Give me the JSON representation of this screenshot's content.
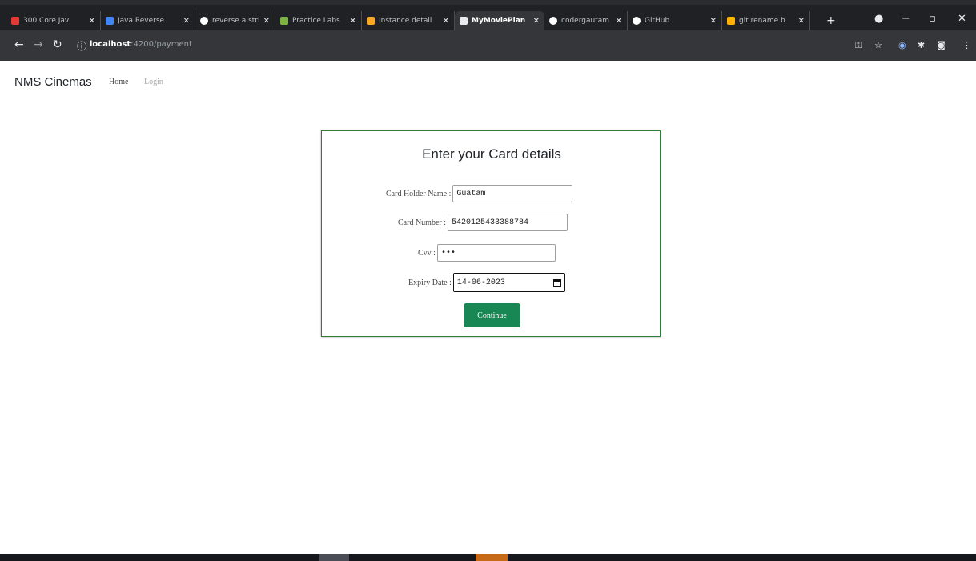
{
  "browser": {
    "tabs": [
      {
        "label": "300 Core Jav",
        "fav_color": "#e53935",
        "active": false
      },
      {
        "label": "Java Reverse",
        "fav_color": "#4285f4",
        "active": false
      },
      {
        "label": "reverse a strin",
        "fav_color": "#ffffff",
        "active": false
      },
      {
        "label": "Practice Labs",
        "fav_color": "#7cb342",
        "active": false
      },
      {
        "label": "Instance detail",
        "fav_color": "#f9a825",
        "active": false
      },
      {
        "label": "MyMoviePlan",
        "fav_color": "#e8eaed",
        "active": true
      },
      {
        "label": "codergautam",
        "fav_color": "#ffffff",
        "active": false
      },
      {
        "label": "GitHub",
        "fav_color": "#ffffff",
        "active": false
      },
      {
        "label": "git rename b",
        "fav_color": "#ffb300",
        "active": false
      }
    ],
    "url_host": "localhost",
    "url_path": ":4200/payment"
  },
  "navbar": {
    "brand": "NMS Cinemas",
    "links": [
      {
        "label": "Home",
        "color": "#444444"
      },
      {
        "label": "Login",
        "color": "#aaaaaa"
      }
    ]
  },
  "form": {
    "title": "Enter your Card details",
    "fields": {
      "holder": {
        "label": "Card Holder Name :",
        "value": "Guatam"
      },
      "number": {
        "label": "Card Number :",
        "value": "5420125433388784"
      },
      "cvv": {
        "label": "Cvv :",
        "value": "•••"
      },
      "expiry": {
        "label": "Expiry Date :",
        "value": "14-06-2023"
      }
    },
    "submit_label": "Continue"
  },
  "colors": {
    "accent_green": "#198754",
    "card_border": "#2e7d32",
    "chrome_dark": "#202124"
  }
}
